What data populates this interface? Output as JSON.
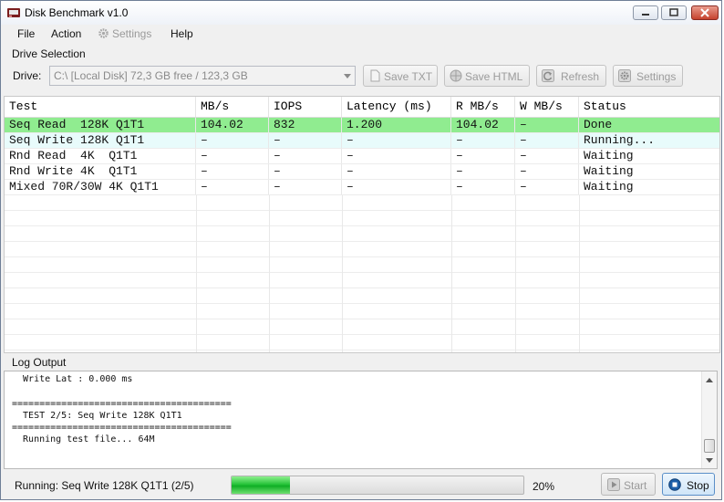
{
  "window": {
    "title": "Disk Benchmark v1.0",
    "controls": {
      "minimize": "minimize-button",
      "maximize": "maximize-button",
      "close": "close-button"
    }
  },
  "menu": {
    "file": "File",
    "action": "Action",
    "settings": "Settings",
    "help": "Help"
  },
  "drive_selection": {
    "group_label": "Drive Selection",
    "drive_label": "Drive:",
    "drive_value": "C:\\  [Local Disk]  72,3 GB free / 123,3 GB",
    "buttons": {
      "save_txt": "Save TXT",
      "save_html": "Save HTML",
      "refresh": "Refresh",
      "settings": "Settings"
    }
  },
  "table": {
    "columns": [
      "Test",
      "MB/s",
      "IOPS",
      "Latency (ms)",
      "R MB/s",
      "W MB/s",
      "Status"
    ],
    "rows": [
      {
        "test": "Seq Read  128K Q1T1",
        "mbs": "104.02",
        "iops": "832",
        "latency": "1.200",
        "rmbs": "104.02",
        "wmbs": "–",
        "status": "Done"
      },
      {
        "test": "Seq Write 128K Q1T1",
        "mbs": "–",
        "iops": "–",
        "latency": "–",
        "rmbs": "–",
        "wmbs": "–",
        "status": "Running..."
      },
      {
        "test": "Rnd Read  4K  Q1T1",
        "mbs": "–",
        "iops": "–",
        "latency": "–",
        "rmbs": "–",
        "wmbs": "–",
        "status": "Waiting"
      },
      {
        "test": "Rnd Write 4K  Q1T1",
        "mbs": "–",
        "iops": "–",
        "latency": "–",
        "rmbs": "–",
        "wmbs": "–",
        "status": "Waiting"
      },
      {
        "test": "Mixed 70R/30W 4K Q1T1",
        "mbs": "–",
        "iops": "–",
        "latency": "–",
        "rmbs": "–",
        "wmbs": "–",
        "status": "Waiting"
      }
    ],
    "colors": {
      "done_row": "#90ec90",
      "running_row": "#e8fbfb"
    }
  },
  "log": {
    "label": "Log Output",
    "lines": [
      "  Write Lat : 0.000 ms",
      "",
      "",
      "========================================",
      "  TEST 2/5: Seq Write 128K Q1T1",
      "========================================",
      "  Running test file... 64M"
    ]
  },
  "status_bar": {
    "text": "Running: Seq Write 128K Q1T1 (2/5)",
    "progress_percent": 20,
    "progress_label": "20%",
    "start_label": "Start",
    "stop_label": "Stop"
  }
}
